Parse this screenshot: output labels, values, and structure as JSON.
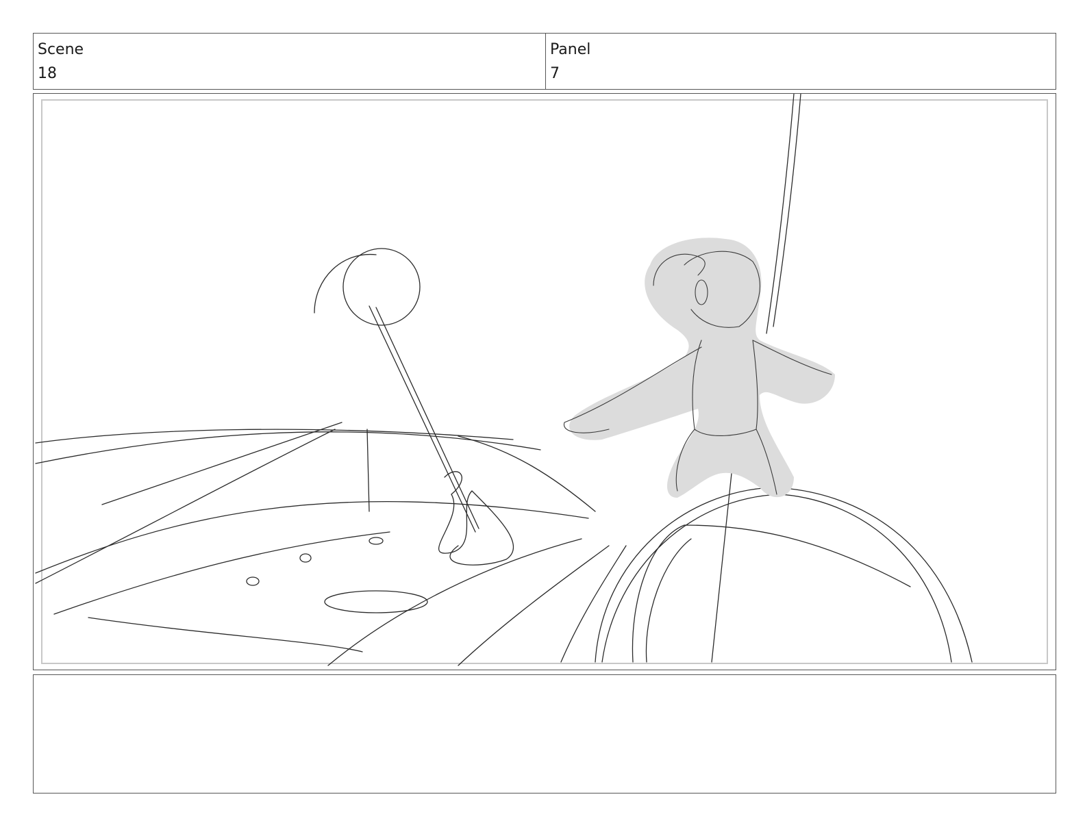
{
  "header": {
    "scene_label": "Scene",
    "scene_value": "18",
    "panel_label": "Panel",
    "panel_value": "7"
  },
  "colors": {
    "border": "#555555",
    "safe_area": "#c8c8c8",
    "sketch_line": "#2a2a2a",
    "character_fill": "#dcdcdc"
  },
  "notes": {
    "text": ""
  }
}
